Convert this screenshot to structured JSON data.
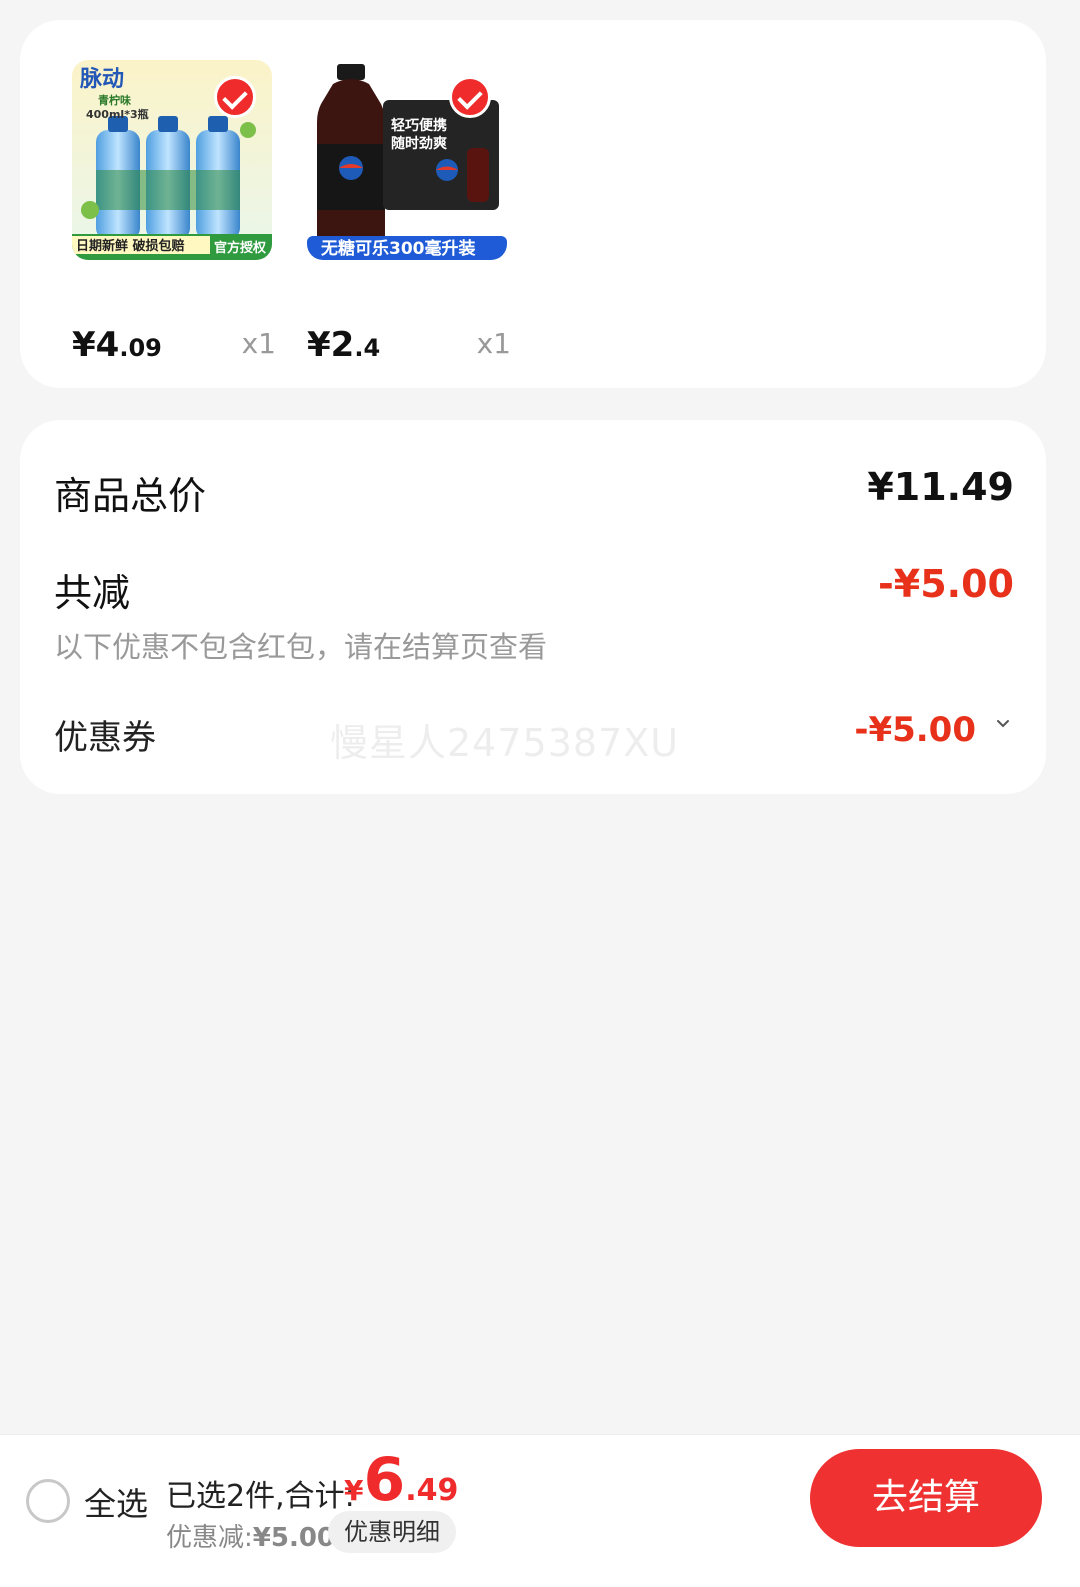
{
  "products": [
    {
      "image_texts": [
        "脉动",
        "青柠味",
        "400ml*3瓶",
        "日期新鲜 破损包赔",
        "官方授权"
      ],
      "price_yuan": "¥4",
      "price_cents": ".09",
      "quantity": "x1",
      "selected": true
    },
    {
      "image_texts": [
        "轻巧便携",
        "随时劲爽",
        "无糖可乐300毫升装"
      ],
      "price_yuan": "¥2",
      "price_cents": ".4",
      "quantity": "x1",
      "selected": true
    }
  ],
  "summary": {
    "total_label": "商品总价",
    "total_value": "¥11.49",
    "discount_label": "共减",
    "discount_value": "-¥5.00",
    "discount_note": "以下优惠不包含红包，请在结算页查看",
    "coupon_label": "优惠券",
    "coupon_value": "-¥5.00",
    "watermark": "慢星人2475387XU"
  },
  "bottom_bar": {
    "select_all_label": "全选",
    "selected_text": "已选2件,合计:",
    "grand_total_currency": "¥",
    "grand_total_int": "6",
    "grand_total_cents": ".49",
    "savings_label": "优惠减:",
    "savings_amount": "¥5.00",
    "details_label": "优惠明细",
    "checkout_label": "去结算"
  },
  "colors": {
    "accent_red": "#ef2b2b",
    "discount_red": "#e8311a",
    "page_bg": "#f5f5f5"
  }
}
